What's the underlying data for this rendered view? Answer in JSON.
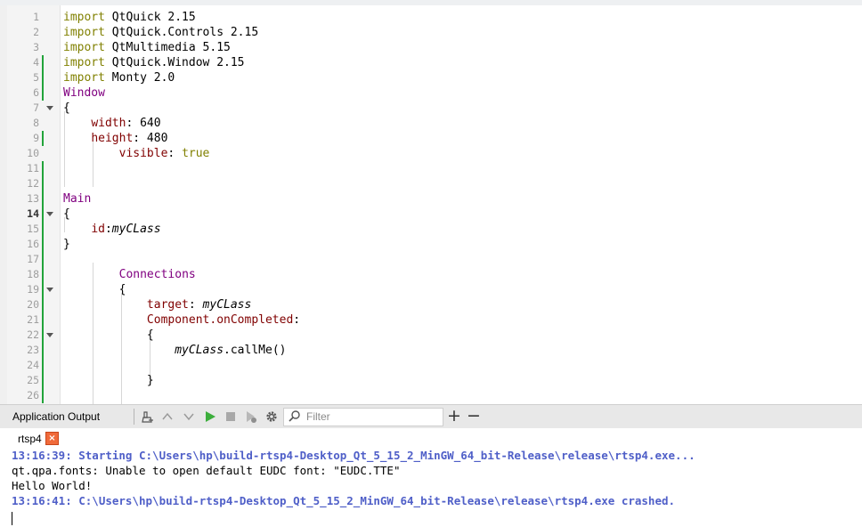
{
  "editor": {
    "lines": [
      {
        "num": "1",
        "text": "import QtQuick 2.15"
      },
      {
        "num": "2",
        "text": "import QtQuick.Controls 2.15"
      },
      {
        "num": "3",
        "text": "import QtMultimedia 5.15"
      },
      {
        "num": "4",
        "text": "import QtQuick.Window 2.15"
      },
      {
        "num": "5",
        "text": "import Monty 2.0"
      },
      {
        "num": "6",
        "text": "Window"
      },
      {
        "num": "7",
        "text": "{"
      },
      {
        "num": "8",
        "text": "width: 640"
      },
      {
        "num": "9",
        "text": "height: 480"
      },
      {
        "num": "10",
        "text": "visible: true"
      },
      {
        "num": "11",
        "text": ""
      },
      {
        "num": "12",
        "text": ""
      },
      {
        "num": "13",
        "text": "Main"
      },
      {
        "num": "14",
        "text": "{"
      },
      {
        "num": "15",
        "text": "id:myCLass"
      },
      {
        "num": "16",
        "text": "}"
      },
      {
        "num": "17",
        "text": ""
      },
      {
        "num": "18",
        "text": "Connections"
      },
      {
        "num": "19",
        "text": "{"
      },
      {
        "num": "20",
        "text": "target: myCLass"
      },
      {
        "num": "21",
        "text": "Component.onCompleted:"
      },
      {
        "num": "22",
        "text": "{"
      },
      {
        "num": "23",
        "text": "myCLass.callMe()"
      },
      {
        "num": "24",
        "text": ""
      },
      {
        "num": "25",
        "text": "}"
      },
      {
        "num": "26",
        "text": ""
      }
    ]
  },
  "output_pane": {
    "title": "Application Output",
    "filter_placeholder": "Filter",
    "add_label": "+",
    "remove_label": "−",
    "tab_label": "rtsp4",
    "tab_close": "×",
    "icons": [
      "clean-output-icon",
      "previous-icon",
      "next-icon",
      "run-icon",
      "stop-icon",
      "attach-debugger-icon",
      "settings-icon",
      "filter-search-icon"
    ],
    "lines": [
      "13:16:39: Starting C:\\Users\\hp\\build-rtsp4-Desktop_Qt_5_15_2_MinGW_64_bit-Release\\release\\rtsp4.exe...",
      "qt.qpa.fonts: Unable to open default EUDC font: \"EUDC.TTE\"",
      "Hello World!",
      "13:16:41: C:\\Users\\hp\\build-rtsp4-Desktop_Qt_5_15_2_MinGW_64_bit-Release\\release\\rtsp4.exe crashed."
    ]
  },
  "colors": {
    "keyword": "#808000",
    "type": "#800080",
    "property": "#800000",
    "message_blue": "#4f5fc8",
    "modified_marker": "#22a33a",
    "run_green": "#3cae3c",
    "close_orange": "#f06a3a"
  }
}
